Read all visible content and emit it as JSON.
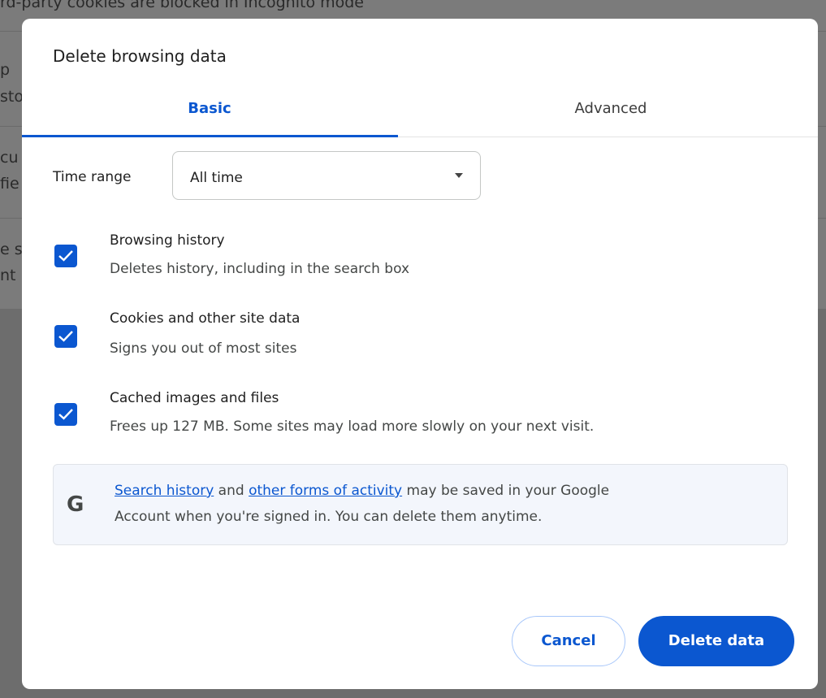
{
  "background": {
    "top_text": "rd-party cookies are blocked in Incognito mode",
    "fragments": [
      "p",
      "sto",
      "cu",
      "fie",
      "e s",
      "nt"
    ]
  },
  "dialog": {
    "title": "Delete browsing data",
    "tabs": [
      {
        "label": "Basic",
        "selected": true
      },
      {
        "label": "Advanced",
        "selected": false
      }
    ],
    "time_range": {
      "label": "Time range",
      "value": "All time"
    },
    "options": [
      {
        "title": "Browsing history",
        "description": "Deletes history, including in the search box",
        "checked": true
      },
      {
        "title": "Cookies and other site data",
        "description": "Signs you out of most sites",
        "checked": true
      },
      {
        "title": "Cached images and files",
        "description": "Frees up 127 MB. Some sites may load more slowly on your next visit.",
        "checked": true
      }
    ],
    "info": {
      "icon": "google-g-icon",
      "icon_text": "G",
      "link1": "Search history",
      "text1": " and ",
      "link2": "other forms of activity",
      "text2": " may be saved in your Google",
      "line2": "Account when you're signed in. You can delete them anytime."
    },
    "buttons": {
      "cancel": "Cancel",
      "delete": "Delete data"
    }
  },
  "colors": {
    "accent": "#0b57d0",
    "info_bg": "#f3f6fc"
  }
}
